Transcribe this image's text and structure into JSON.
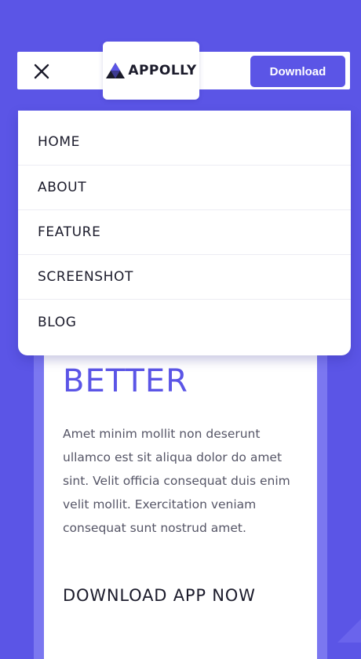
{
  "brand": {
    "name": "APPOLLY",
    "logo_icon": "triangle-logo-icon"
  },
  "header": {
    "close_icon": "close-icon",
    "download_label": "Download"
  },
  "menu": {
    "items": [
      {
        "label": "HOME"
      },
      {
        "label": "ABOUT"
      },
      {
        "label": "FEATURE"
      },
      {
        "label": "SCREENSHOT"
      },
      {
        "label": "BLOG"
      }
    ]
  },
  "hero": {
    "heading": "BETTER",
    "body": "Amet minim mollit non deserunt ullamco est sit aliqua dolor do amet sint. Velit officia consequat duis enim velit mollit. Exercitation veniam consequat sunt nostrud amet.",
    "cta_heading": "DOWNLOAD APP NOW"
  },
  "colors": {
    "brand_primary": "#5b55e6",
    "card_border": "#7b77f0",
    "text_dark": "#1b1b2b",
    "text_body": "#555566"
  }
}
